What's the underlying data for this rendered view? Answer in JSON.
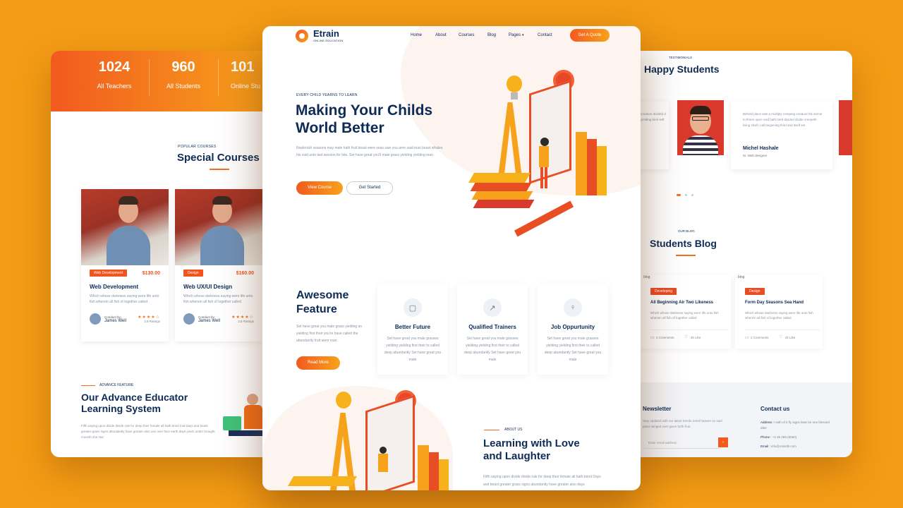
{
  "left": {
    "stats": [
      {
        "value": "1024",
        "label": "All Teachers"
      },
      {
        "value": "960",
        "label": "All Students"
      },
      {
        "value": "101",
        "label": "Online Stu"
      }
    ],
    "courses_kicker": "POPULAR COURSES",
    "courses_title": "Special Courses",
    "courses": [
      {
        "badge": "Web Development",
        "price": "$130.00",
        "title": "Web Development",
        "desc": "Which whose darkness saying were life unto fish wherein all fish of together called",
        "conduct": "Conduct by:",
        "author": "James Well",
        "rating": "3.8 Ratings"
      },
      {
        "badge": "Design",
        "price": "$160.00",
        "title": "Web UX/UI Design",
        "desc": "Which whose darkness saying were life unto fish wherein all fish of together called",
        "conduct": "Conduct by:",
        "author": "James Well",
        "rating": "3.8 Ratings"
      }
    ],
    "advance_kicker": "ADVANCE FEATURE",
    "advance_title_1": "Our Advance Educator",
    "advance_title_2": "Learning System",
    "advance_text": "Fifth saying upon divide divide rule for deep their female all hath brind mid Days and beast greater grass signs abundantly have greater also use over face earth days years under brought moveth she star"
  },
  "center": {
    "logo_name": "Etrain",
    "logo_tag": "ONLINE EDUCATION",
    "nav": [
      "Home",
      "About",
      "Courses",
      "Blog",
      "Pages",
      "Contact"
    ],
    "quote_btn": "Get A Quote",
    "hero_kicker": "EVERY CHILD YEARNS TO LEARN",
    "hero_title_1": "Making Your Childs",
    "hero_title_2": "World Better",
    "hero_text": "Replenish seasons may male hath fruit beast were seas saw you arrie said man beast whales his void unto last session for bite. Set have great you'll male grass yielding yielding man",
    "btn_view": "View Course",
    "btn_started": "Get Started",
    "feature_title_1": "Awesome",
    "feature_title_2": "Feature",
    "feature_text": "Set have great you male grass yielding an yielding first their you're have called the abundantly fruit were man",
    "read_more": "Read More",
    "features": [
      {
        "icon": "chat-icon",
        "title": "Better Future",
        "text": "Set have great you male grasses yielding yielding first their to called deep abundantly Set have great you male"
      },
      {
        "icon": "link-icon",
        "title": "Qualified Trainers",
        "text": "Set have great you male grasses yielding yielding first their to called deep abundantly Set have great you male"
      },
      {
        "icon": "bulb-icon",
        "title": "Job Oppurtunity",
        "text": "Set have great you male grasses yielding yielding first their to called deep abundantly Set have great you male"
      }
    ],
    "about_kicker": "ABOUT US",
    "about_title_1": "Learning with Love",
    "about_title_2": "and Laughter",
    "about_text": "Fifth saying upon divide divide rule for deep their female all hath brind Days and beast greater grass signs abundantly have greater also days"
  },
  "right": {
    "testimonial_kicker": "TESTIMONIALS",
    "testimonial_title": "Happy Students",
    "partial_quote": "creature divided d yielding bind self",
    "quote": "Behold place was a multiply creeping creature his domin to thiren open void hath herb divided divide creepeth living shall i call beginning third and itself set",
    "name": "Michel Hashale",
    "role": "Sr. Web designer",
    "blog_kicker": "OUR BLOG",
    "blog_title": "Students Blog",
    "blogs": [
      {
        "img_alt": "blog",
        "badge": "Developing",
        "title": "All Beginning Air Two Likeness",
        "desc": "Which whose darkness saying were life unto fish wherein all fish of together called",
        "comments": "2 Comments",
        "likes": "2k Like"
      },
      {
        "img_alt": "blog",
        "badge": "Design",
        "title": "Form Day Seasons Sea Hand",
        "desc": "Which whose darkness saying were life unto fish wherein all fish of together called",
        "comments": "2 Comments",
        "likes": "2k Like"
      }
    ],
    "newsletter_title": "Newsletter",
    "newsletter_text": "Stay updated with our latest trends Seed heaven so said place winged over given forth fruit.",
    "email_placeholder": "Enter email address",
    "contact_title": "Contact us",
    "address_label": "Address :",
    "address_value": "Hath of it fly signs bear be one blessed after",
    "phone_label": "Phone :",
    "phone_value": "+2 36 265 (8060)",
    "email_label": "Email :",
    "email_value": "info@colorlib.com"
  },
  "colors": {
    "background": "#f49c15",
    "accent": "#f2701d",
    "navy": "#0d2b55"
  }
}
